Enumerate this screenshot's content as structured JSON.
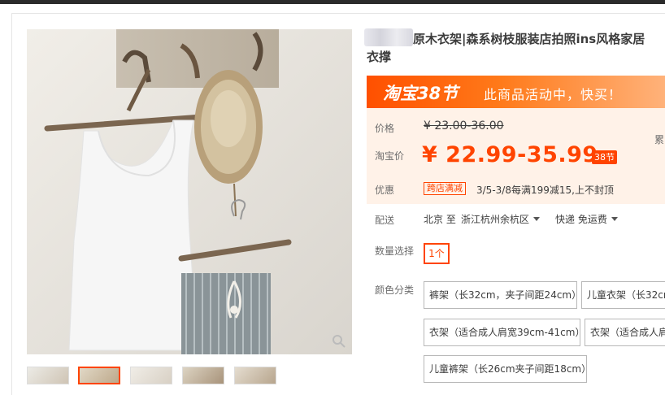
{
  "title": {
    "line1": "原木衣架|森系树枝服装店拍照ins风格家居",
    "line2": "衣撑"
  },
  "promo": {
    "logo": "淘宝38节",
    "text": "此商品活动中，快买！"
  },
  "price": {
    "label": "价格",
    "original": "¥ 23.00-36.00",
    "sale_label": "淘宝价",
    "sale": "¥ 22.99-35.99",
    "badge": "38节",
    "sales_cut": "累"
  },
  "discount": {
    "label": "优惠",
    "tag": "跨店满减",
    "text": "3/5-3/8每满199减15,上不封顶"
  },
  "shipping": {
    "label": "配送",
    "from": "北京 至",
    "to": "浙江杭州余杭区",
    "method": "快递 免运费"
  },
  "quantity": {
    "label": "数量选择",
    "value": "1个"
  },
  "color": {
    "label": "颜色分类",
    "options": [
      "裤架（长32cm，夹子间距24cm）",
      "儿童衣架（长32cm",
      "衣架（适合成人肩宽39cm-41cm）",
      "衣架（适合成人肩",
      "儿童裤架（长26cm夹子间距18cm）"
    ]
  },
  "colors": {
    "accent": "#ff4400",
    "promo_start": "#ff5000",
    "price_bg": "#fff2e8"
  },
  "icons": [
    "zoom-icon",
    "caret-down-icon"
  ]
}
